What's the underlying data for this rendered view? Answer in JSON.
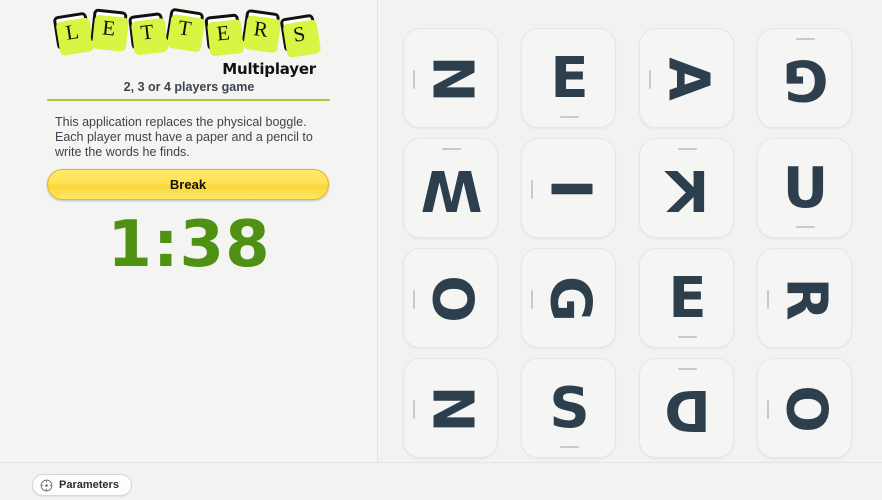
{
  "app": {
    "background_color": "#f2f2f2",
    "accent_green": "#4f9112",
    "letter_color": "#2d3e4c",
    "logo_glow_color": "#d9f442"
  },
  "logo": {
    "letters": [
      "L",
      "E",
      "T",
      "T",
      "E",
      "R",
      "S"
    ],
    "subtitle": "Multiplayer"
  },
  "sidebar": {
    "players_line": "2, 3 or 4 players game",
    "blurb": "This application replaces the physical boggle. Each player must have a paper and a pencil to write the words he finds.",
    "break_button": "Break",
    "timer": "1:38"
  },
  "bottom_bar": {
    "parameters_label": "Parameters",
    "gear_icon": "gear-icon"
  },
  "board": {
    "rows": 4,
    "columns": 4,
    "tiles": [
      {
        "letter": "N",
        "rotation": 90
      },
      {
        "letter": "E",
        "rotation": 0
      },
      {
        "letter": "A",
        "rotation": 90
      },
      {
        "letter": "G",
        "rotation": 180
      },
      {
        "letter": "W",
        "rotation": 180
      },
      {
        "letter": "I",
        "rotation": 90
      },
      {
        "letter": "K",
        "rotation": 180
      },
      {
        "letter": "U",
        "rotation": 0
      },
      {
        "letter": "O",
        "rotation": 90
      },
      {
        "letter": "G",
        "rotation": 90
      },
      {
        "letter": "E",
        "rotation": 0
      },
      {
        "letter": "R",
        "rotation": 90
      },
      {
        "letter": "N",
        "rotation": 90
      },
      {
        "letter": "S",
        "rotation": 0
      },
      {
        "letter": "D",
        "rotation": 180
      },
      {
        "letter": "O",
        "rotation": 90
      }
    ]
  }
}
